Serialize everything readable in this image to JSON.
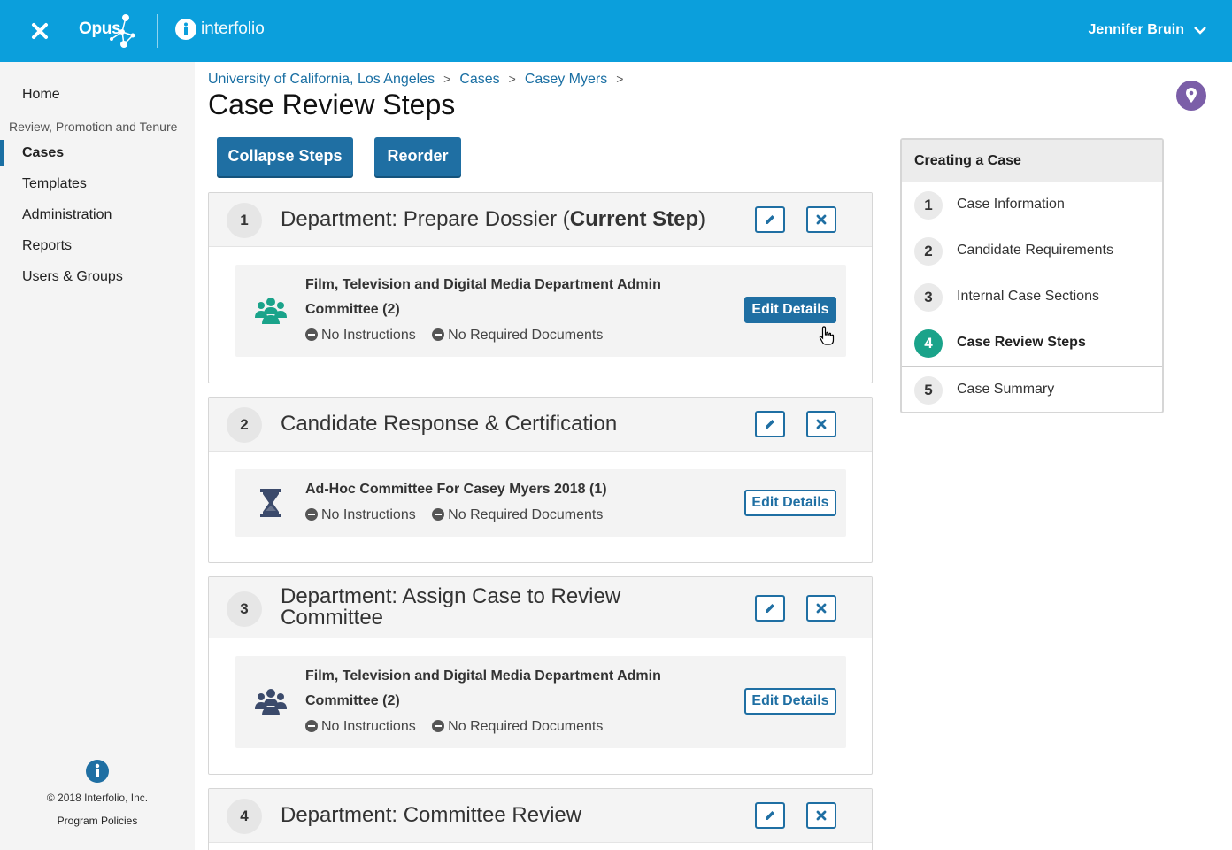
{
  "header": {
    "brand": "Opus",
    "partner": "interfolio",
    "user_name": "Jennifer Bruin"
  },
  "sidebar": {
    "items": [
      {
        "label": "Home"
      },
      {
        "label": "Cases",
        "active": true
      },
      {
        "label": "Templates"
      },
      {
        "label": "Administration"
      },
      {
        "label": "Reports"
      },
      {
        "label": "Users & Groups"
      }
    ],
    "section_label": "Review, Promotion and Tenure",
    "copyright": "© 2018 Interfolio, Inc.",
    "policies": "Program Policies"
  },
  "breadcrumb": [
    "University of California, Los Angeles",
    "Cases",
    "Casey Myers"
  ],
  "page": {
    "title": "Case Review Steps",
    "collapse_label": "Collapse Steps",
    "reorder_label": "Reorder"
  },
  "steps": [
    {
      "number": "1",
      "title": "Department: Prepare Dossier (",
      "title_bold": "Current Step",
      "title_end": ")",
      "task": {
        "name": "Film, Television and Digital Media Department Admin Committee (2)",
        "icon": "group-icon",
        "icon_color": "#1aa38a",
        "instructions": "No Instructions",
        "documents": "No Required Documents",
        "action": "Edit Details"
      }
    },
    {
      "number": "2",
      "title": "Candidate Response & Certification",
      "task": {
        "name": "Ad-Hoc Committee For Casey Myers 2018 (1)",
        "icon": "hourglass-icon",
        "icon_color": "#3b4a6b",
        "instructions": "No Instructions",
        "documents": "No Required Documents",
        "action": "Edit Details"
      }
    },
    {
      "number": "3",
      "title": "Department: Assign Case to Review Committee",
      "task": {
        "name": "Film, Television and Digital Media Department Admin Committee (2)",
        "icon": "group-icon",
        "icon_color": "#3b4a6b",
        "instructions": "No Instructions",
        "documents": "No Required Documents",
        "action": "Edit Details"
      }
    },
    {
      "number": "4",
      "title": "Department: Committee Review"
    }
  ],
  "wizard": {
    "title": "Creating a Case",
    "items": [
      {
        "number": "1",
        "label": "Case Information"
      },
      {
        "number": "2",
        "label": "Candidate Requirements"
      },
      {
        "number": "3",
        "label": "Internal Case Sections"
      },
      {
        "number": "4",
        "label": "Case Review Steps",
        "active": true
      },
      {
        "number": "5",
        "label": "Case Summary"
      }
    ]
  },
  "colors": {
    "topbar": "#0b9fdc",
    "primary": "#1f6fa3",
    "accent_green": "#1aa38a",
    "location_purple": "#7b5ea8"
  }
}
